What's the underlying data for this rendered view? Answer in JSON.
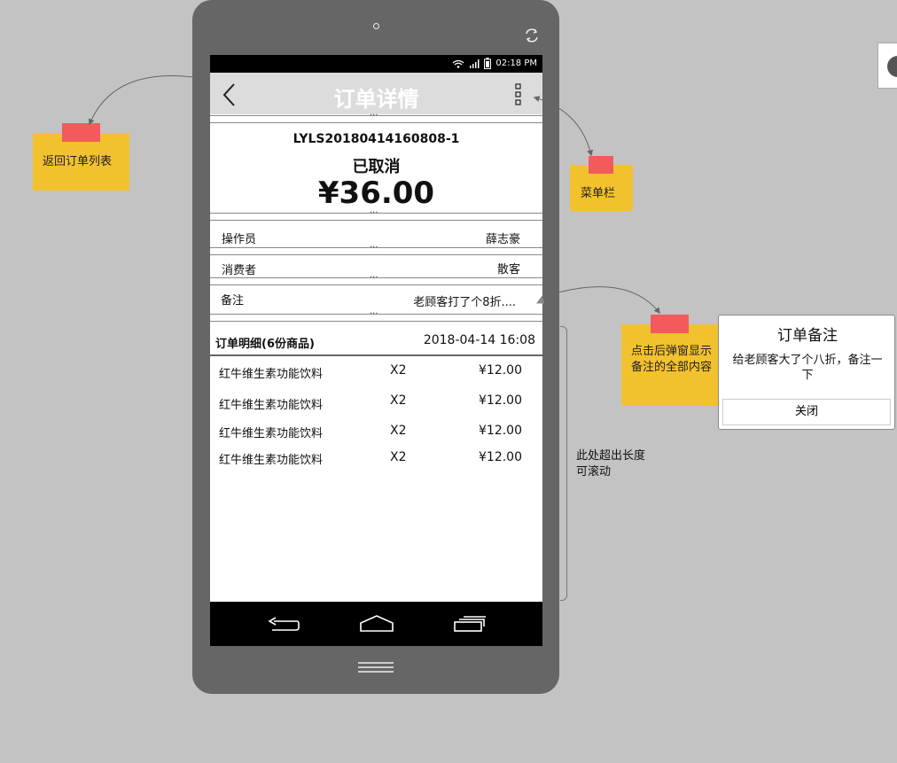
{
  "screen": {
    "status_time": "02:18 PM",
    "title": "订单详情",
    "order_no": "LYLS20180414160808-1",
    "status": "已取消",
    "amount": "¥36.00",
    "operator_label": "操作员",
    "operator_value": "薛志豪",
    "consumer_label": "消费者",
    "consumer_value": "散客",
    "remark_label": "备注",
    "remark_value": "老顾客打了个8折....",
    "detail_title": "订单明细(6份商品)",
    "detail_time": "2018-04-14 16:08",
    "items": [
      {
        "name": "红牛维生素功能饮料",
        "qty": "X2",
        "price": "¥12.00"
      },
      {
        "name": "红牛维生素功能饮料",
        "qty": "X2",
        "price": "¥12.00"
      },
      {
        "name": "红牛维生素功能饮料",
        "qty": "X2",
        "price": "¥12.00"
      },
      {
        "name": "红牛维生素功能饮料",
        "qty": "X2",
        "price": "¥12.00"
      }
    ]
  },
  "annotations": {
    "back_note": "返回订单列表",
    "menu_note": "菜单栏",
    "remark_note": "点击后弹窗显示备注的全部内容",
    "scroll_note": "此处超出长度可滚动"
  },
  "dialog": {
    "title": "订单备注",
    "body": "给老顾客大了个八折，备注一下",
    "close_label": "关闭"
  },
  "colors": {
    "background": "#c3c3c3",
    "phone_frame": "#666666",
    "topbar": "#dcdcdc",
    "sticky_note": "#f2c12e",
    "note_flag": "#f25b5b"
  }
}
